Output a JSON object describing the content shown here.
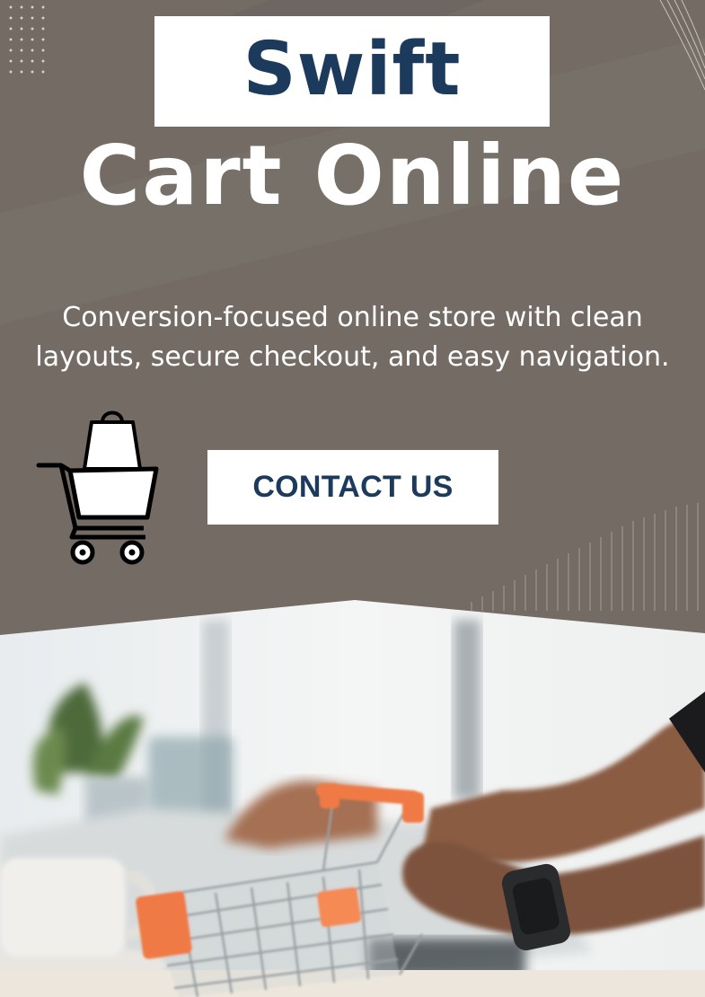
{
  "brand": {
    "title_line1": "Swift",
    "title_line2": "Cart Online"
  },
  "tagline": {
    "line1": "Conversion-focused online store with clean",
    "line2": "layouts, secure checkout, and easy navigation."
  },
  "cta": {
    "label": "CONTACT US"
  },
  "icons": {
    "cart": "shopping-cart-with-bag-icon"
  },
  "colors": {
    "background": "#736b64",
    "title_blue": "#1c3a5c",
    "white": "#ffffff",
    "cart_orange": "#f07a45"
  }
}
